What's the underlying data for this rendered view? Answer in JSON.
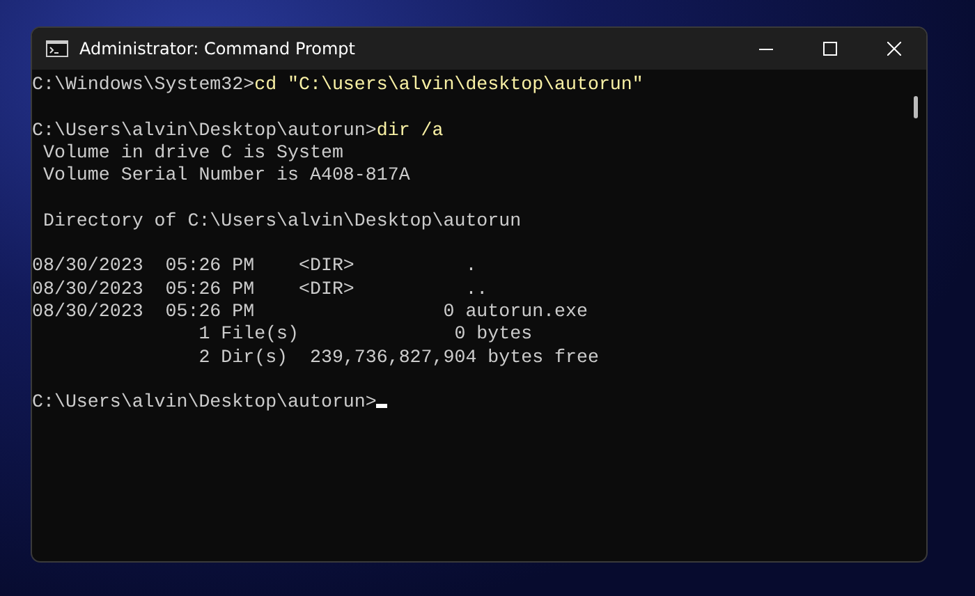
{
  "window": {
    "title": "Administrator: Command Prompt"
  },
  "console": {
    "lines": [
      {
        "kind": "prompt",
        "prompt": "C:\\Windows\\System32>",
        "command": "cd \"C:\\users\\alvin\\desktop\\autorun\"",
        "cursor": false
      },
      {
        "kind": "blank"
      },
      {
        "kind": "prompt",
        "prompt": "C:\\Users\\alvin\\Desktop\\autorun>",
        "command": "dir /a",
        "cursor": false
      },
      {
        "kind": "output",
        "text": " Volume in drive C is System"
      },
      {
        "kind": "output",
        "text": " Volume Serial Number is A408-817A"
      },
      {
        "kind": "blank"
      },
      {
        "kind": "output",
        "text": " Directory of C:\\Users\\alvin\\Desktop\\autorun"
      },
      {
        "kind": "blank"
      },
      {
        "kind": "output",
        "text": "08/30/2023  05:26 PM    <DIR>          ."
      },
      {
        "kind": "output",
        "text": "08/30/2023  05:26 PM    <DIR>          .."
      },
      {
        "kind": "output",
        "text": "08/30/2023  05:26 PM                 0 autorun.exe"
      },
      {
        "kind": "output",
        "text": "               1 File(s)              0 bytes"
      },
      {
        "kind": "output",
        "text": "               2 Dir(s)  239,736,827,904 bytes free"
      },
      {
        "kind": "blank"
      },
      {
        "kind": "prompt",
        "prompt": "C:\\Users\\alvin\\Desktop\\autorun>",
        "cursor": true
      }
    ]
  }
}
